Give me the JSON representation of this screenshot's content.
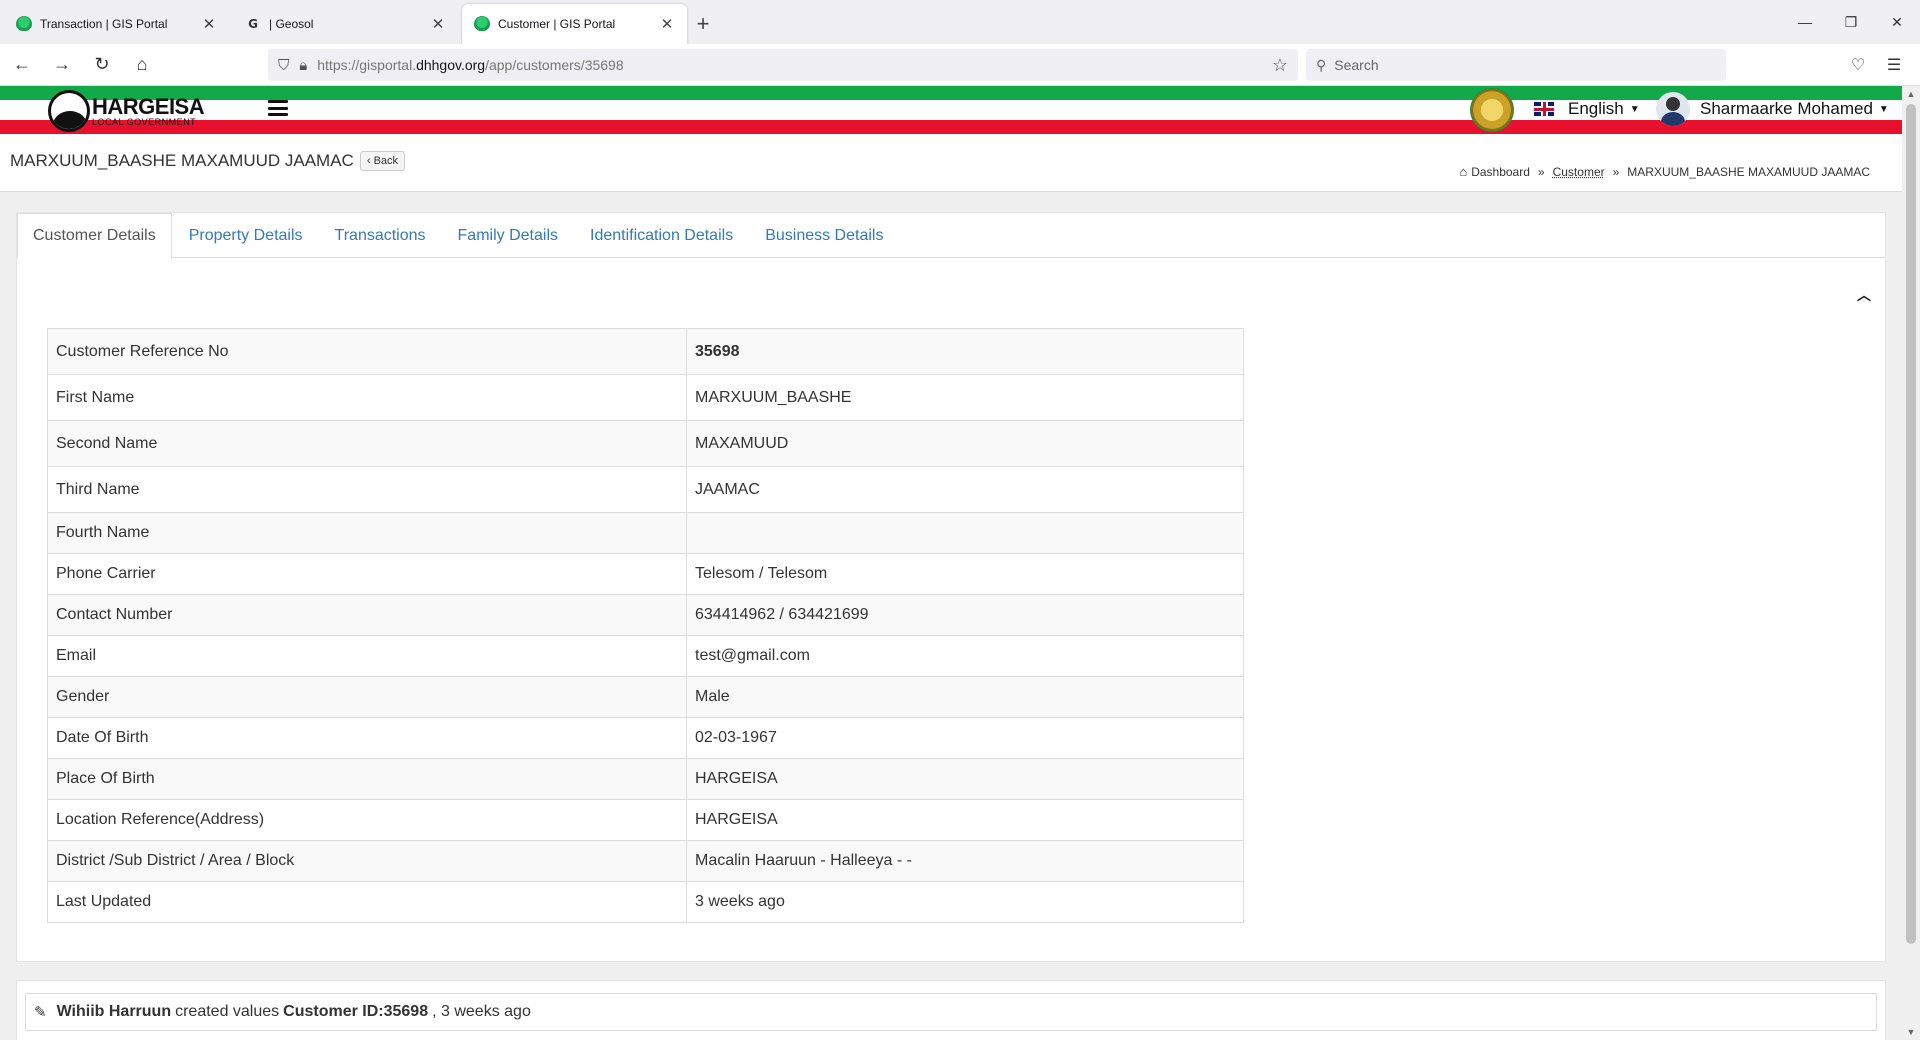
{
  "browser": {
    "tabs": [
      {
        "title": "Transaction | GIS Portal"
      },
      {
        "title": "| Geosol"
      },
      {
        "title": "Customer | GIS Portal"
      }
    ],
    "url_prefix": "https://gisportal.",
    "url_domain": "dhhgov.org",
    "url_path": "/app/customers/35698",
    "search_placeholder": "Search"
  },
  "app": {
    "logo_title": "HARGEISA",
    "logo_subtitle": "LOCAL GOVERNMENT",
    "logo_mark": "DHH",
    "language": "English",
    "user_name": "Sharmaarke Mohamed"
  },
  "page": {
    "title": "MARXUUM_BAASHE MAXAMUUD JAAMAC",
    "back_label": "Back",
    "breadcrumb": [
      "Dashboard",
      "Customer",
      "MARXUUM_BAASHE MAXAMUUD JAAMAC"
    ]
  },
  "tabs": [
    "Customer Details",
    "Property Details",
    "Transactions",
    "Family Details",
    "Identification Details",
    "Business Details"
  ],
  "details": [
    {
      "label": "Customer Reference No",
      "value": "35698"
    },
    {
      "label": "First Name",
      "value": "MARXUUM_BAASHE"
    },
    {
      "label": "Second Name",
      "value": "MAXAMUUD"
    },
    {
      "label": "Third Name",
      "value": "JAAMAC"
    },
    {
      "label": "Fourth Name",
      "value": ""
    },
    {
      "label": "Phone Carrier",
      "value": "Telesom / Telesom"
    },
    {
      "label": "Contact Number",
      "value": "634414962 / 634421699"
    },
    {
      "label": "Email",
      "value": "test@gmail.com"
    },
    {
      "label": "Gender",
      "value": "Male"
    },
    {
      "label": "Date Of Birth",
      "value": "02-03-1967"
    },
    {
      "label": "Place Of Birth",
      "value": "HARGEISA"
    },
    {
      "label": "Location Reference(Address)",
      "value": "HARGEISA"
    },
    {
      "label": "District /Sub District / Area / Block",
      "value": "Macalin Haaruun - Halleeya - -"
    },
    {
      "label": "Last Updated",
      "value": "3 weeks ago"
    }
  ],
  "activity": {
    "user": "Wihiib Harruun",
    "action": "created values",
    "target": "Customer ID:35698",
    "time": ", 3 weeks ago"
  },
  "icons": {
    "back": "chevron-left-icon",
    "home": "home-icon",
    "collapse": "chevron-up-icon",
    "edit": "edit-icon"
  }
}
